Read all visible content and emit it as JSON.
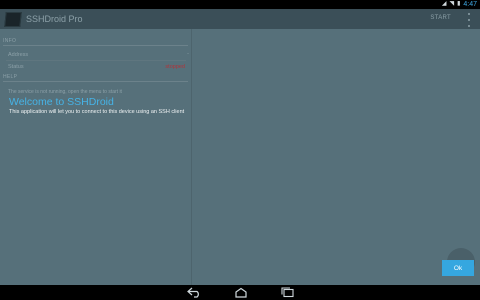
{
  "status_bar": {
    "time": "4:47"
  },
  "action_bar": {
    "title": "SSHDroid Pro",
    "start_label": "START",
    "overflow_icon": "overflow-menu-icon"
  },
  "info_section": {
    "header": "INFO",
    "rows": [
      {
        "label": "Address",
        "value": "-",
        "value_color": "#8ca0a8"
      },
      {
        "label": "Status",
        "value": "stopped",
        "value_color": "#b0343a"
      }
    ]
  },
  "help_section": {
    "header": "HELP",
    "text": "The service is not running, open the menu to start it"
  },
  "tutorial": {
    "title": "Welcome to SSHDroid",
    "body": "This application will let you to connect to this device using an SSH client",
    "ok_label": "Ok"
  },
  "colors": {
    "accent": "#35a7e0",
    "status_stopped": "#b0343a"
  }
}
